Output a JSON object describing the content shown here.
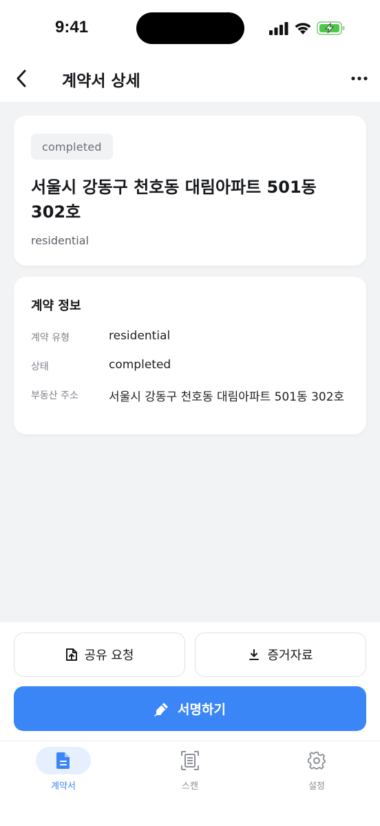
{
  "status_bar": {
    "time": "9:41"
  },
  "nav": {
    "title": "계약서 상세"
  },
  "summary": {
    "status": "completed",
    "title": "서울시 강동구 천호동 대림아파트 501동 302호",
    "type": "residential"
  },
  "info": {
    "heading": "계약 정보",
    "rows": [
      {
        "label": "계약 유형",
        "value": "residential"
      },
      {
        "label": "상태",
        "value": "completed"
      },
      {
        "label": "부동산 주소",
        "value": "서울시 강동구 천호동 대림아파트 501동 302호"
      }
    ]
  },
  "actions": {
    "share_label": "공유 요청",
    "evidence_label": "증거자료",
    "sign_label": "서명하기"
  },
  "tabs": [
    {
      "label": "계약서",
      "icon": "document-icon",
      "active": true
    },
    {
      "label": "스캔",
      "icon": "scan-icon",
      "active": false
    },
    {
      "label": "설정",
      "icon": "gear-icon",
      "active": false
    }
  ],
  "colors": {
    "accent": "#3b86f6",
    "background": "#f2f3f5",
    "badge_bg": "#f1f2f4"
  }
}
